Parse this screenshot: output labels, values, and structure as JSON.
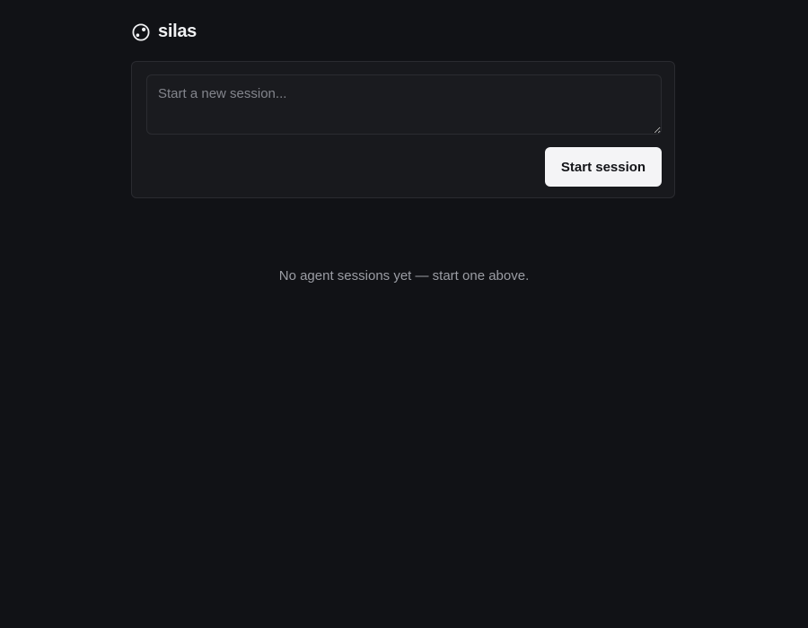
{
  "app": {
    "brand": "silas",
    "logo_icon": "orbit-logo-icon"
  },
  "composer": {
    "placeholder": "Start a new session...",
    "value": "",
    "submit_label": "Start session"
  },
  "sessions": {
    "items": [],
    "empty_message": "No agent sessions yet — start one above."
  },
  "colors": {
    "background": "#111216",
    "panel": "#18191d",
    "border": "#2a2b30",
    "button_bg": "#f4f4f6",
    "button_text": "#131418",
    "muted_text": "#9b9da4"
  }
}
